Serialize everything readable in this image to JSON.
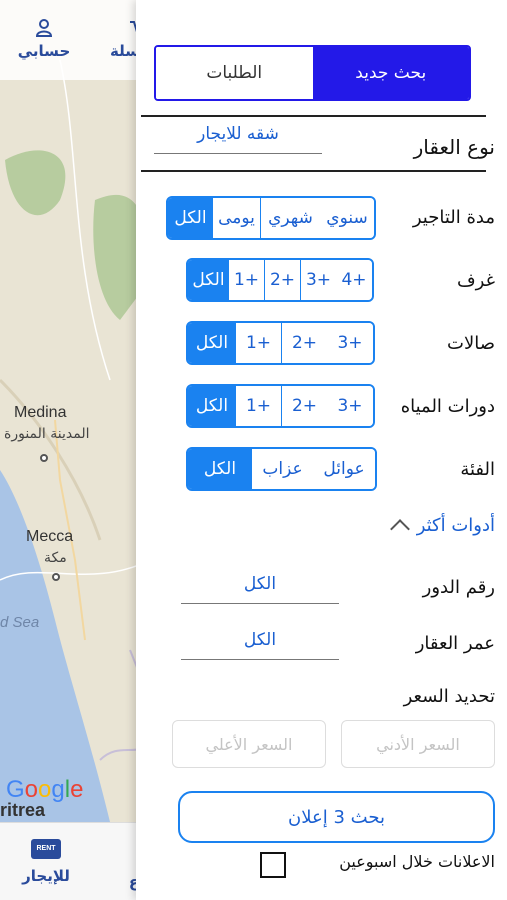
{
  "map": {
    "cities": [
      {
        "name": "Medina",
        "name_ar": "المدينة المنورة"
      },
      {
        "name": "Mecca",
        "name_ar": "مكة"
      }
    ],
    "sea_label": "d Sea",
    "google": "Google",
    "country": "ritrea"
  },
  "top_nav": {
    "account": "حسابي",
    "partial": "سلة"
  },
  "tab_bar": {
    "rent": "للإيجار",
    "rent_badge": "RENT",
    "partial": "ع"
  },
  "panel": {
    "top_tabs": {
      "new_search": "بحث جديد",
      "requests": "الطلبات"
    },
    "property_type": {
      "label": "نوع العقار",
      "value": "شقه للايجار"
    },
    "rent_period": {
      "label": "مدة التاجير",
      "options": [
        "سنوي",
        "شهري",
        "يومى",
        "الكل"
      ],
      "selected": 3
    },
    "rooms": {
      "label": "غرف",
      "options": [
        "4+",
        "3+",
        "2+",
        "1+",
        "الكل"
      ],
      "selected": 4
    },
    "halls": {
      "label": "صالات",
      "options": [
        "3+",
        "2+",
        "1+",
        "الكل"
      ],
      "selected": 3
    },
    "bathrooms": {
      "label": "دورات المياه",
      "options": [
        "3+",
        "2+",
        "1+",
        "الكل"
      ],
      "selected": 3
    },
    "category": {
      "label": "الفئة",
      "options": [
        "عوائل",
        "عزاب",
        "الكل"
      ],
      "selected": 2
    },
    "more_tools": "أدوات أكثر",
    "floor": {
      "label": "رقم الدور",
      "value": "الكل"
    },
    "age": {
      "label": "عمر العقار",
      "value": "الكل"
    },
    "price": {
      "label": "تحديد السعر",
      "min_placeholder": "السعر الأدني",
      "max_placeholder": "السعر الأعلي"
    },
    "search_button": "بحث 3 إعلان",
    "two_weeks": "الاعلانات خلال اسبوعين"
  },
  "colors": {
    "accent": "#1a82f0",
    "top_tab": "#2319e8"
  }
}
